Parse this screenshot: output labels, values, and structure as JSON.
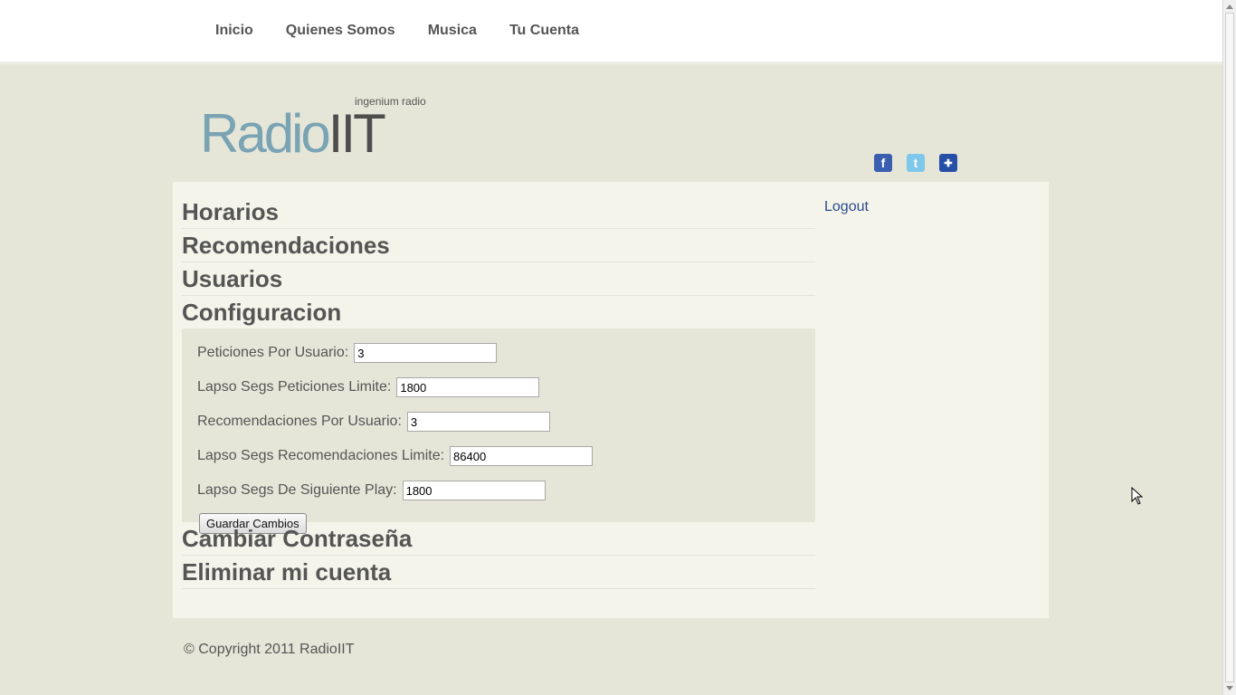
{
  "nav": {
    "items": [
      {
        "label": "Inicio"
      },
      {
        "label": "Quienes Somos"
      },
      {
        "label": "Musica"
      },
      {
        "label": "Tu Cuenta"
      }
    ]
  },
  "header": {
    "tagline": "ingenium radio",
    "logo_part1": "Radio",
    "logo_part2": "IIT"
  },
  "social": {
    "icons": [
      "facebook-icon",
      "twitter-icon",
      "myspace-icon"
    ]
  },
  "accordion": {
    "sections": [
      {
        "title": "Horarios"
      },
      {
        "title": "Recomendaciones"
      },
      {
        "title": "Usuarios"
      },
      {
        "title": "Configuracion"
      },
      {
        "title": "Cambiar Contraseña"
      },
      {
        "title": "Eliminar mi cuenta"
      }
    ],
    "config": {
      "fields": [
        {
          "label": "Peticiones Por Usuario:",
          "value": "3"
        },
        {
          "label": "Lapso Segs Peticiones Limite:",
          "value": "1800"
        },
        {
          "label": "Recomendaciones Por Usuario:",
          "value": "3"
        },
        {
          "label": "Lapso Segs Recomendaciones Limite:",
          "value": "86400"
        },
        {
          "label": "Lapso Segs De Siguiente Play:",
          "value": "1800"
        }
      ],
      "save_label": "Guardar Cambios"
    }
  },
  "sidebar": {
    "logout_label": "Logout"
  },
  "footer": {
    "copyright": "© Copyright 2011 RadioIIT"
  },
  "colors": {
    "background": "#e6e6d8",
    "panel": "#f4f4ea",
    "logo_radio": "#7aa3b4",
    "logo_iit": "#4e4e4e",
    "link": "#2a4b8e"
  }
}
